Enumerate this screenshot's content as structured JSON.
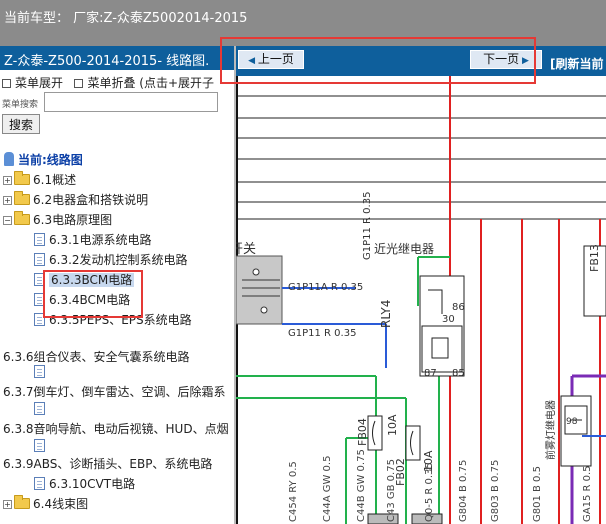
{
  "header": {
    "text": "当前车型：  厂家:Z-众泰Z5002014-2015"
  },
  "left_panel": {
    "title": "Z-众泰-Z500-2014-2015- 线路图.",
    "menu_expand": "菜单展开",
    "menu_collapse": "菜单折叠 (点击+展开子",
    "search_label": "菜单搜索",
    "search_value": "",
    "search_button": "搜索"
  },
  "tree": {
    "root": "当前:线路图",
    "items": [
      {
        "label": "6.1概述",
        "type": "folder",
        "toggle": "+"
      },
      {
        "label": "6.2电器盒和搭铁说明",
        "type": "folder",
        "toggle": "+"
      },
      {
        "label": "6.3电路原理图",
        "type": "folder",
        "toggle": "−"
      },
      {
        "label": "6.3.1电源系统电路",
        "type": "page"
      },
      {
        "label": "6.3.2发动机控制系统电路",
        "type": "page"
      },
      {
        "label": "6.3.3BCM电路",
        "type": "page"
      },
      {
        "label": "6.3.4BCM电路",
        "type": "page"
      },
      {
        "label": "6.3.5PEPS、EPS系统电路",
        "type": "page"
      },
      {
        "label": "6.3.6组合仪表、安全气囊系统电路",
        "type": "text"
      },
      {
        "label": "6.3.7倒车灯、倒车雷达、空调、后除霜系",
        "type": "text"
      },
      {
        "label": "6.3.8音响导航、电动后视镜、HUD、点烟",
        "type": "text"
      },
      {
        "label": "6.3.9ABS、诊断插头、EBP、系统电路",
        "type": "text"
      },
      {
        "label": "6.3.10CVT电路",
        "type": "page"
      },
      {
        "label": "6.4线束图",
        "type": "folder",
        "toggle": "+"
      }
    ]
  },
  "viewer": {
    "prev_button": "上一页",
    "next_button": "下一页",
    "refresh_label": "[刷新当前",
    "diagram_labels": {
      "switch": "开关",
      "relay_name": "近光继电器",
      "relay_id": "RLY4",
      "fuse1_id": "FB04",
      "fuse1_rating": "10A",
      "fuse2_id": "FB02",
      "fuse2_rating": "10A",
      "wire_g1p11a": "G1P11A R 0.35",
      "wire_g1p11": "G1P11 R 0.35",
      "wire_g1p11_v": "G1P11 R 0.35",
      "side_relay": "前雾灯继电器",
      "fb13": "FB13",
      "pin_86": "86",
      "pin_30": "30",
      "pin_87": "87",
      "pin_85": "85",
      "pin_98": "98",
      "bottom_wires": [
        "C454 RY 0.5",
        "C44A GW 0.5",
        "C44B GW 0.75",
        "C43 GB 0.75",
        "Q0-5 R 0.35",
        "G804 B 0.75",
        "G803 B 0.75",
        "G801 B 0.5",
        "GA15 R 0.5"
      ]
    }
  }
}
